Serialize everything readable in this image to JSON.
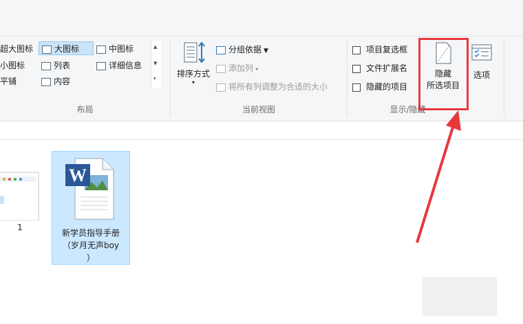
{
  "layout": {
    "label": "布局",
    "items": [
      {
        "label": "超大图标",
        "selected": false
      },
      {
        "label": "大图标",
        "selected": true
      },
      {
        "label": "中图标",
        "selected": false
      },
      {
        "label": "小图标",
        "selected": false
      },
      {
        "label": "列表",
        "selected": false
      },
      {
        "label": "详细信息",
        "selected": false
      },
      {
        "label": "平铺",
        "selected": false
      },
      {
        "label": "内容",
        "selected": false
      }
    ]
  },
  "current_view": {
    "label": "当前视图",
    "sort_by": "排序方式",
    "group_by": "分组依据",
    "add_column": "添加列",
    "fit_columns": "将所有列调整为合适的大小"
  },
  "show_hide": {
    "label": "显示/隐藏",
    "item_checkboxes": "项目复选框",
    "file_extensions": "文件扩展名",
    "hidden_items": "隐藏的项目",
    "hide_selected_line1": "隐藏",
    "hide_selected_line2": "所选项目",
    "options": "选项"
  },
  "files": [
    {
      "name": "1",
      "selected": false
    },
    {
      "name": "新学员指导手册（岁月无声boy）",
      "selected": true
    }
  ],
  "file2_lines": [
    "新学员指导手册",
    "（岁月无声boy",
    "）"
  ],
  "colors": {
    "highlight": "#e8383d",
    "selection": "#cce8ff"
  }
}
